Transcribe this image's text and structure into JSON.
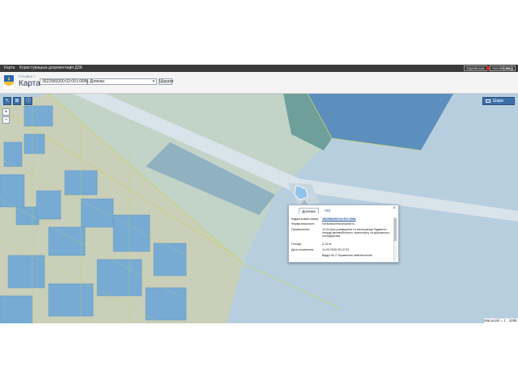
{
  "topbar": {
    "menu_map": "Карта",
    "menu_manual": "Користувацька документація ДЗК",
    "menu_arrow": "•",
    "lang_1": "Українська",
    "lang_2": "Англійська",
    "lang_3": "Вхід"
  },
  "header": {
    "breadcrumb": "Головна >",
    "title": "Карта"
  },
  "search": {
    "value": "3522583200:02:001:0084",
    "layer": "Ділянка",
    "button_label": "Шукати"
  },
  "map_controls": {
    "zoom_in": "+",
    "zoom_out": "−",
    "layers_label": "Шари"
  },
  "scale": {
    "text": "Масштаб = 1 : 4286"
  },
  "popup": {
    "tab_parcel": "Ділянка",
    "tab_other": "НМ",
    "close": "×",
    "rows": [
      {
        "label": "Кадастровий номер:",
        "value": "3522583200:02:001:0084"
      },
      {
        "label": "Форма власності:",
        "value": "На визначена власність"
      },
      {
        "label": "Призначення:",
        "value": "12.04 Для розміщення та експлуатації будівель і споруд автомобільного транспорту та дорожнього господарства"
      },
      {
        "label": "Площа:",
        "value": "0.13 га"
      },
      {
        "label": "Дата оновлення:",
        "value": "14.03.2026 09:12:33"
      },
      {
        "label": "",
        "value": "Відділ № 2 Управління забезпечення"
      }
    ]
  },
  "colors": {
    "topbar": "#3a3a3a",
    "accent": "#3d6fa8",
    "parcel_fill": "#6fa8d8",
    "parcel_border": "#c9d26a"
  }
}
